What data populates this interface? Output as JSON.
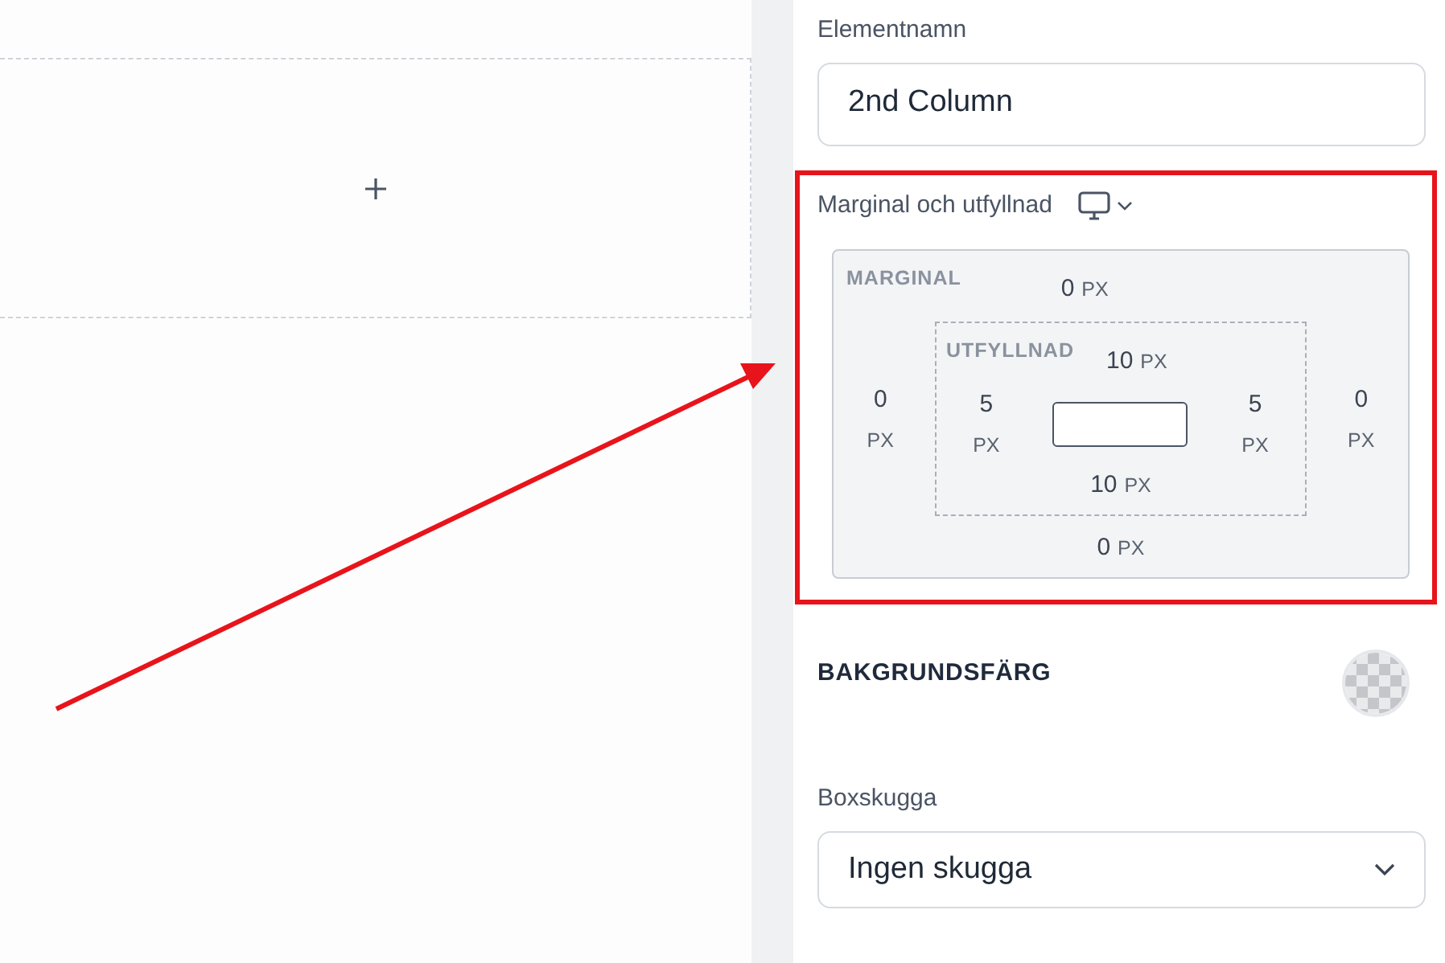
{
  "element_name": {
    "label": "Elementnamn",
    "value": "2nd Column"
  },
  "spacing": {
    "label": "Marginal och utfyllnad",
    "margin": {
      "label": "MARGINAL",
      "top": {
        "value": "0",
        "unit": "PX"
      },
      "left": {
        "value": "0",
        "unit": "PX"
      },
      "right": {
        "value": "0",
        "unit": "PX"
      },
      "bottom": {
        "value": "0",
        "unit": "PX"
      }
    },
    "padding": {
      "label": "UTFYLLNAD",
      "top": {
        "value": "10",
        "unit": "PX"
      },
      "left": {
        "value": "5",
        "unit": "PX"
      },
      "right": {
        "value": "5",
        "unit": "PX"
      },
      "bottom": {
        "value": "10",
        "unit": "PX"
      }
    }
  },
  "background_color": {
    "label": "BAKGRUNDSFÄRG"
  },
  "box_shadow": {
    "label": "Boxskugga",
    "value": "Ingen skugga"
  }
}
